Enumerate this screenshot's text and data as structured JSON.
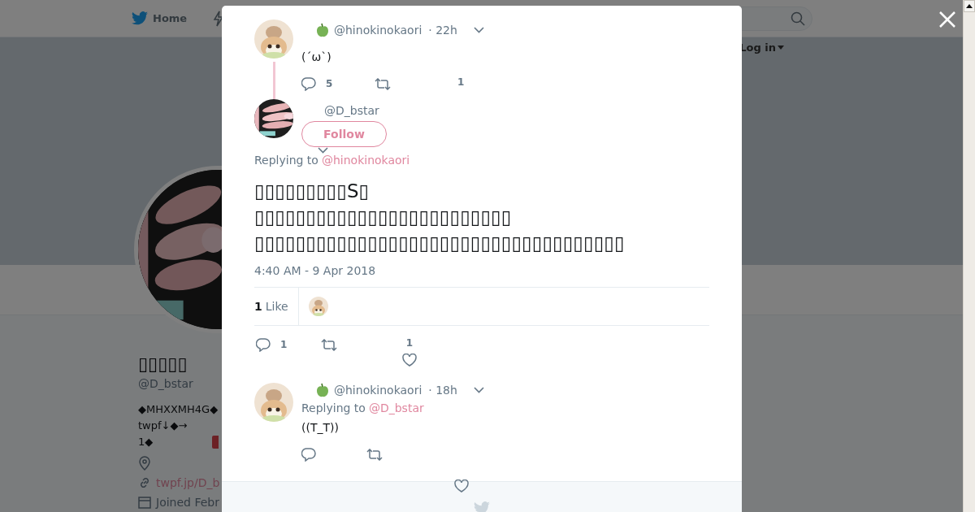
{
  "page": {
    "nav": {
      "home": "Home",
      "login": "Log in"
    },
    "profile": {
      "name": "▯▯▯▯▯",
      "handle": "@D_bstar",
      "bio": [
        "◆MHXXMH4G◆",
        "twpf↓◆→",
        "1◆"
      ],
      "link": "twpf.jp/D_b",
      "joined": "Joined Febr"
    }
  },
  "modal": {
    "parent": {
      "handle": "@hinokinokaori",
      "time": "· 22h",
      "text": "(´ω`)",
      "reply_count": "5",
      "like_count": "1"
    },
    "focused": {
      "handle": "@D_bstar",
      "follow": "Follow",
      "replying_label": "Replying to",
      "replying_to": "@hinokinokaori",
      "lines": [
        "▯▯▯▯▯▯▯▯▯S▯",
        "▯▯▯▯▯▯▯▯▯▯▯▯▯▯▯▯▯▯▯▯▯▯▯▯▯",
        "▯▯▯▯▯▯▯▯▯▯▯▯▯▯▯▯▯▯▯▯▯▯▯▯▯▯▯▯▯▯▯▯▯▯▯▯"
      ],
      "timestamp": "4:40 AM - 9 Apr 2018",
      "likes": {
        "count": "1",
        "label": "Like"
      },
      "reply_count": "1",
      "like_count": "1"
    },
    "reply": {
      "handle": "@hinokinokaori",
      "time": "· 18h",
      "replying_label": "Replying to",
      "replying_to": "@D_bstar",
      "text": "((T_T))"
    }
  }
}
